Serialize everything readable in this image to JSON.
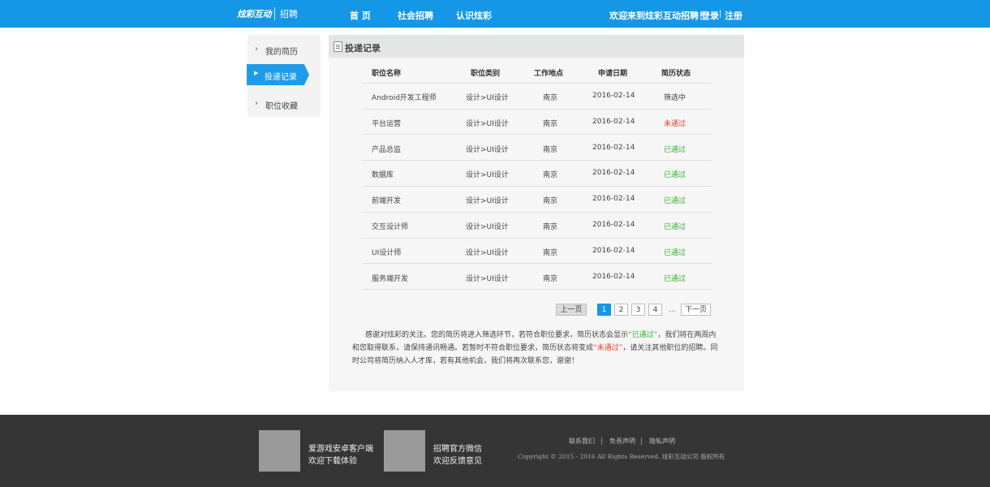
{
  "header": {
    "logo_mark": "炫彩互动",
    "logo_sub": "招聘",
    "nav": [
      "首 页",
      "社会招聘",
      "认识炫彩"
    ],
    "welcome": "欢迎来到炫彩互动招聘！",
    "login": "登录",
    "register": "注册",
    "bg_color": "#1497e6"
  },
  "sidebar": {
    "items": [
      {
        "label": "我的简历"
      },
      {
        "label": "投递记录",
        "active": true
      },
      {
        "label": "职位收藏"
      }
    ]
  },
  "panel": {
    "title": "投递记录",
    "columns": [
      "职位名称",
      "职位类别",
      "工作地点",
      "申请日期",
      "简历状态"
    ],
    "rows": [
      {
        "name": "Android开发工程师",
        "category": "设计>UI设计",
        "location": "南京",
        "date": "2016-02-14",
        "status": "筛选中",
        "status_type": "neutral"
      },
      {
        "name": "平台运营",
        "category": "设计>UI设计",
        "location": "南京",
        "date": "2016-02-14",
        "status": "未通过",
        "status_type": "no"
      },
      {
        "name": "产品总监",
        "category": "设计>UI设计",
        "location": "南京",
        "date": "2016-02-14",
        "status": "已通过",
        "status_type": "ok"
      },
      {
        "name": "数据库",
        "category": "设计>UI设计",
        "location": "南京",
        "date": "2016-02-14",
        "status": "已通过",
        "status_type": "ok"
      },
      {
        "name": "前端开发",
        "category": "设计>UI设计",
        "location": "南京",
        "date": "2016-02-14",
        "status": "已通过",
        "status_type": "ok"
      },
      {
        "name": "交互设计师",
        "category": "设计>UI设计",
        "location": "南京",
        "date": "2016-02-14",
        "status": "已通过",
        "status_type": "ok"
      },
      {
        "name": "UI设计师",
        "category": "设计>UI设计",
        "location": "南京",
        "date": "2016-02-14",
        "status": "已通过",
        "status_type": "ok"
      },
      {
        "name": "服务端开发",
        "category": "设计>UI设计",
        "location": "南京",
        "date": "2016-02-14",
        "status": "已通过",
        "status_type": "ok"
      }
    ],
    "pagination": {
      "prev": "上一页",
      "pages": [
        "1",
        "2",
        "3",
        "4"
      ],
      "current": "1",
      "ellipsis": "...",
      "next": "下一页"
    },
    "notice": {
      "part1": "感谢对炫彩的关注。您的简历将进入筛选环节，若符合职位要求，简历状态会显示",
      "passed": "“已通过”",
      "part2": "，我们将在两周内和您取得联系，请保持通讯畅通。若暂时不符合职位要求，简历状态将变成",
      "failed": "“未通过”",
      "part3": "，请关注其他职位的招聘。同时公司将简历纳入人才库，若有其他机会，我们将再次联系您，谢谢！"
    }
  },
  "footer": {
    "app_line1": "爱游戏安卓客户端",
    "app_line2": "欢迎下载体验",
    "wechat_line1": "招聘官方微信",
    "wechat_line2": "欢迎反馈意见",
    "links": [
      "联系我们",
      "免责声明",
      "隐私声明"
    ],
    "copyright": "Copyright © 2015 - 2016 All Rights Reserved. 炫彩互动公司 版权所有"
  }
}
